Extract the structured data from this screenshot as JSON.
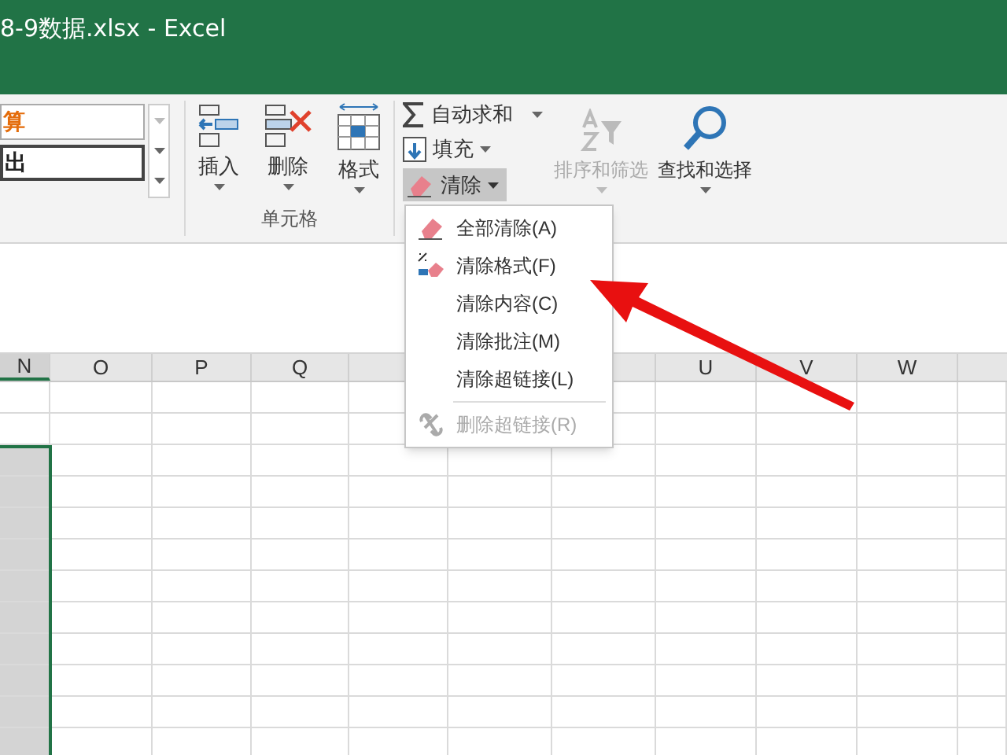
{
  "window": {
    "title": "8-9数据.xlsx  -  Excel"
  },
  "styles": [
    {
      "label": "算",
      "color": "#e46c0a"
    },
    {
      "label": "出",
      "color": "#222222"
    }
  ],
  "cells_group": {
    "label": "单元格",
    "buttons": [
      {
        "kind": "insert",
        "label": "插入"
      },
      {
        "kind": "delete",
        "label": "删除"
      },
      {
        "kind": "format",
        "label": "格式"
      }
    ]
  },
  "editing": {
    "autosum": "自动求和",
    "fill": "填充",
    "clear": {
      "label": "清除",
      "pressed": true
    },
    "sort": {
      "label": "排序和筛选",
      "disabled": true
    },
    "find": "查找和选择"
  },
  "clear_menu": [
    {
      "kind": "eraser",
      "label": "全部清除(A)",
      "disabled": false
    },
    {
      "kind": "format",
      "label": "清除格式(F)",
      "disabled": false
    },
    {
      "kind": "none",
      "label": "清除内容(C)",
      "disabled": false
    },
    {
      "kind": "none",
      "label": "清除批注(M)",
      "disabled": false
    },
    {
      "kind": "none",
      "label": "清除超链接(L)",
      "disabled": false
    },
    {
      "kind": "unlink",
      "label": "删除超链接(R)",
      "disabled": true
    }
  ],
  "columns": [
    {
      "label": "N",
      "selected": true
    },
    {
      "label": "O",
      "selected": false
    },
    {
      "label": "P",
      "selected": false
    },
    {
      "label": "Q",
      "selected": false
    },
    {
      "label": "U",
      "selected": false
    },
    {
      "label": "V",
      "selected": false
    },
    {
      "label": "W",
      "selected": false
    }
  ]
}
